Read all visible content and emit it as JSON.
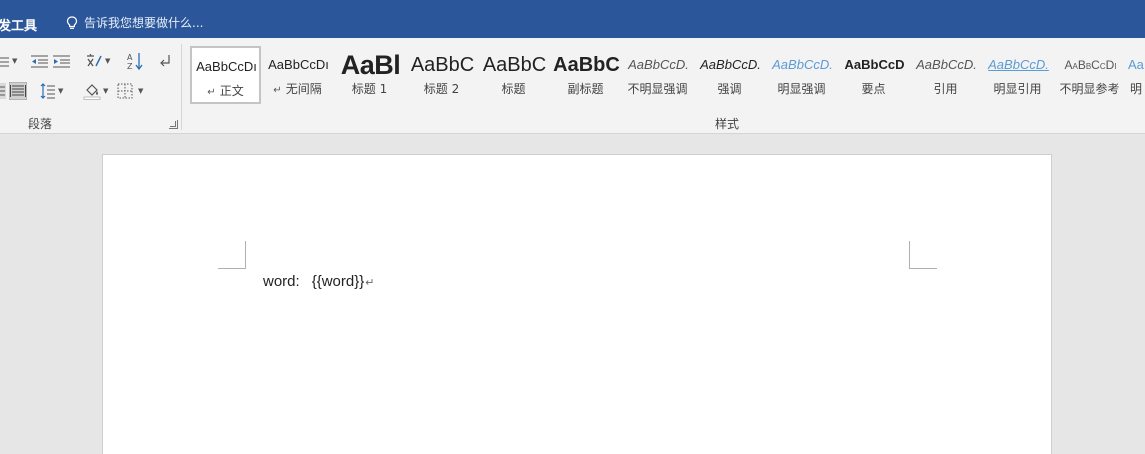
{
  "topbar": {
    "dev_tab": "开发工具",
    "dev_tab_visible": "开发工具",
    "tell_me": "告诉我您想要做什么..."
  },
  "ribbon": {
    "paragraph_group_label": "段落",
    "styles_group_label": "样式",
    "styles": [
      {
        "preview": "AaBbCcDı",
        "name": "正文",
        "mark": "↵"
      },
      {
        "preview": "AaBbCcDı",
        "name": "无间隔",
        "mark": "↵"
      },
      {
        "preview": "AaBl",
        "name": "标题 1"
      },
      {
        "preview": "AaBbC",
        "name": "标题 2"
      },
      {
        "preview": "AaBbC",
        "name": "标题"
      },
      {
        "preview": "AaBbC",
        "name": "副标题"
      },
      {
        "preview": "AaBbCcD.",
        "name": "不明显强调"
      },
      {
        "preview": "AaBbCcD.",
        "name": "强调"
      },
      {
        "preview": "AaBbCcD.",
        "name": "明显强调"
      },
      {
        "preview": "AaBbCcD",
        "name": "要点"
      },
      {
        "preview": "AaBbCcD.",
        "name": "引用"
      },
      {
        "preview": "AaBbCcD.",
        "name": "明显引用"
      },
      {
        "preview": "AaBbCcDı",
        "name": "不明显参考"
      },
      {
        "preview": "Aa",
        "name": "明"
      }
    ],
    "selected_style": "正文",
    "accent_color": "#2b579a"
  },
  "document": {
    "line_label": "word:",
    "line_value": "{{word}}",
    "paragraph_mark": "↵"
  }
}
